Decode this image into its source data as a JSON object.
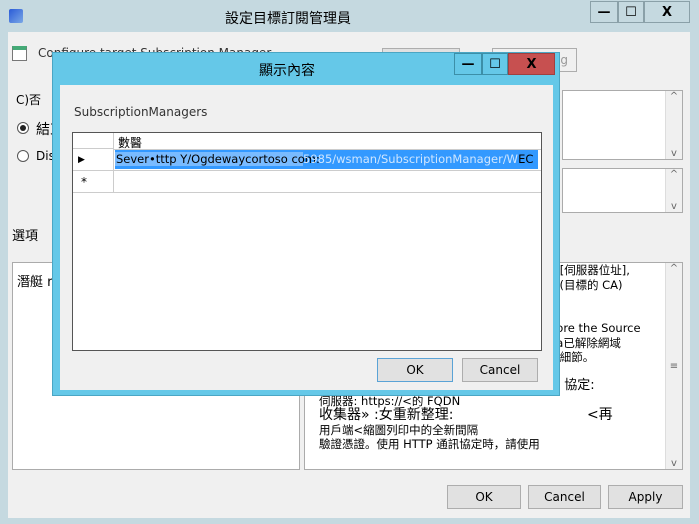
{
  "window": {
    "title": "設定目標訂閱管理員",
    "heading": "Configure target Subscription Manager",
    "minimize": "—",
    "maximize": "☐",
    "close": "X"
  },
  "top_buttons": {
    "second_label": "ng"
  },
  "radios": [
    {
      "label": "C)否",
      "checked": false
    },
    {
      "label": "結束",
      "checked": true
    },
    {
      "label": "Disa",
      "checked": false
    }
  ],
  "options_label": "選項",
  "left_box_text": "潛艇 r",
  "help_lines": [
    "e [伺服器位址],",
    "y (目標的 CA)",
    "",
    "",
    "gore the Source",
    "ua已解除網域",
    "a 細節。",
    "",
    "PS 協定:",
    "伺服器: https://<的 FQDN",
    "收集器» :女重新整理:                              <再",
    "用戶端<縮圖列印中的全新間隔",
    "驗證憑證。使用 HTTP 通訊協定時，請使用"
  ],
  "footer": {
    "ok": "OK",
    "cancel": "Cancel",
    "apply": "Apply"
  },
  "modal": {
    "title": "顯示內容",
    "label": "SubscriptionManagers",
    "column_header": "數醫",
    "rows": [
      {
        "marker": "▶",
        "value_selected": "Sever•tttp Y/Ogdewaycortoso com:",
        "value_rest": "5985/wsman/SubscriptionManager/W",
        "value_tail": "EC Pea"
      },
      {
        "marker": "*",
        "value_selected": "",
        "value_rest": "",
        "value_tail": ""
      }
    ],
    "ok": "OK",
    "cancel": "Cancel",
    "minimize": "—",
    "maximize": "☐",
    "close": "X"
  },
  "colors": {
    "modal_title": "#65c8e8",
    "close": "#c75050",
    "selection": "#3399ff"
  }
}
